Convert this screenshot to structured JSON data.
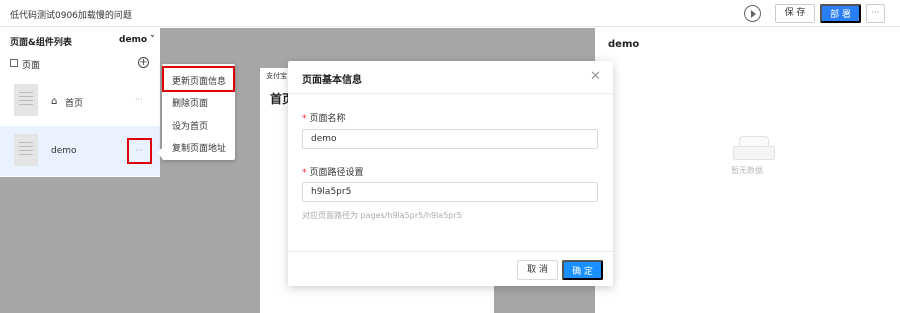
{
  "app": {
    "title": "低代码测试0906加载慢的问题",
    "play_icon": "play-circle-icon",
    "save_label": "保 存",
    "deploy_label": "部 署",
    "more_label": "···"
  },
  "panel": {
    "title": "页面&组件列表",
    "env": "demo ˅",
    "pages_label": "页面",
    "add_icon": "plus-circle-icon",
    "add_glyph": "+",
    "items": [
      {
        "name": "首页",
        "icon": "home-icon",
        "home_glyph": "⌂",
        "more": "···"
      },
      {
        "name": "demo",
        "more": "···",
        "selected": true
      }
    ]
  },
  "context_menu": {
    "items": [
      "更新页面信息",
      "删除页面",
      "设为首页",
      "复制页面地址"
    ]
  },
  "canvas": {
    "page_label": "支付宝",
    "page_title": "首页"
  },
  "right_panel": {
    "title": "demo",
    "empty_text": "暂无数据"
  },
  "modal": {
    "title": "页面基本信息",
    "close_glyph": "✕",
    "fields": [
      {
        "label": "页面名称",
        "value": "demo"
      },
      {
        "label": "页面路径设置",
        "value": "h9la5pr5"
      }
    ],
    "required_mark": "*",
    "hint": "对应页面路径为 pages/h9la5pr5/h9la5pr5",
    "cancel_label": "取 消",
    "confirm_label": "确 定"
  },
  "colors": {
    "primary": "#2a7ff5",
    "confirm": "#1890ff",
    "highlight": "#e0000a",
    "canvas": "#a6a6a6"
  }
}
